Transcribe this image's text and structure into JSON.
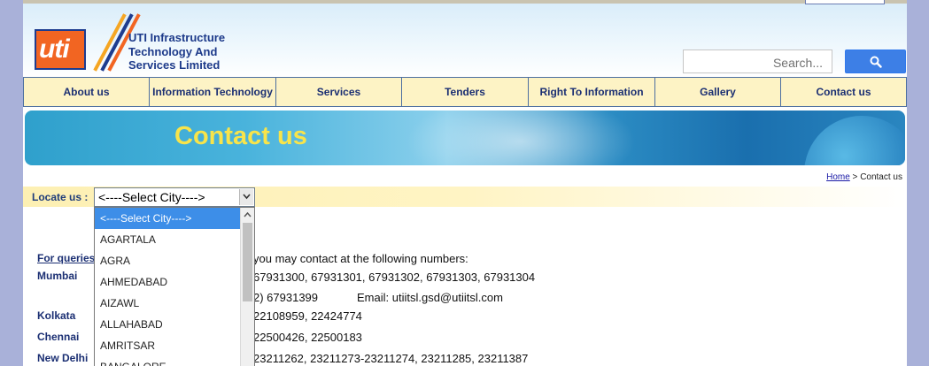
{
  "header": {
    "logo_text": "uti",
    "company_lines": [
      "UTI Infrastructure",
      "Technology And",
      "Services Limited"
    ]
  },
  "search": {
    "placeholder": "Search...",
    "button_icon": "search-icon"
  },
  "nav": {
    "items": [
      "About us",
      "Information Technology",
      "Services",
      "Tenders",
      "Right To Information",
      "Gallery",
      "Contact us"
    ]
  },
  "banner": {
    "title": "Contact us"
  },
  "breadcrumb": {
    "home": "Home",
    "separator": " > ",
    "current": "Contact us"
  },
  "locate": {
    "label": "Locate us :",
    "selected": "<----Select City---->",
    "options": [
      "<----Select City---->",
      "AGARTALA",
      "AGRA",
      "AHMEDABAD",
      "AIZAWL",
      "ALLAHABAD",
      "AMRITSAR",
      "BANGALORE"
    ]
  },
  "contacts": {
    "queries_link": "For queries",
    "intro": "you may contact at the following numbers:",
    "mumbai": {
      "city": "Mumbai",
      "phones": "67931300, 67931301, 67931302, 67931303, 67931304",
      "phones2": "2) 67931399",
      "email": "Email: utiitsl.gsd@utiitsl.com"
    },
    "kolkata": {
      "city": "Kolkata",
      "phones": "22108959, 22424774"
    },
    "chennai": {
      "city": "Chennai",
      "phones": "22500426, 22500183"
    },
    "newdelhi": {
      "city": "New Delhi",
      "phones": "23211262, 23211273-23211274, 23211285, 23211387"
    }
  },
  "colors": {
    "brand_orange": "#f26522",
    "brand_blue": "#1d3c8f",
    "nav_bg": "#fdf3c5",
    "banner_title": "#f8e44a",
    "link": "#1b2f73",
    "dropdown_selected": "#3d8ee8"
  }
}
